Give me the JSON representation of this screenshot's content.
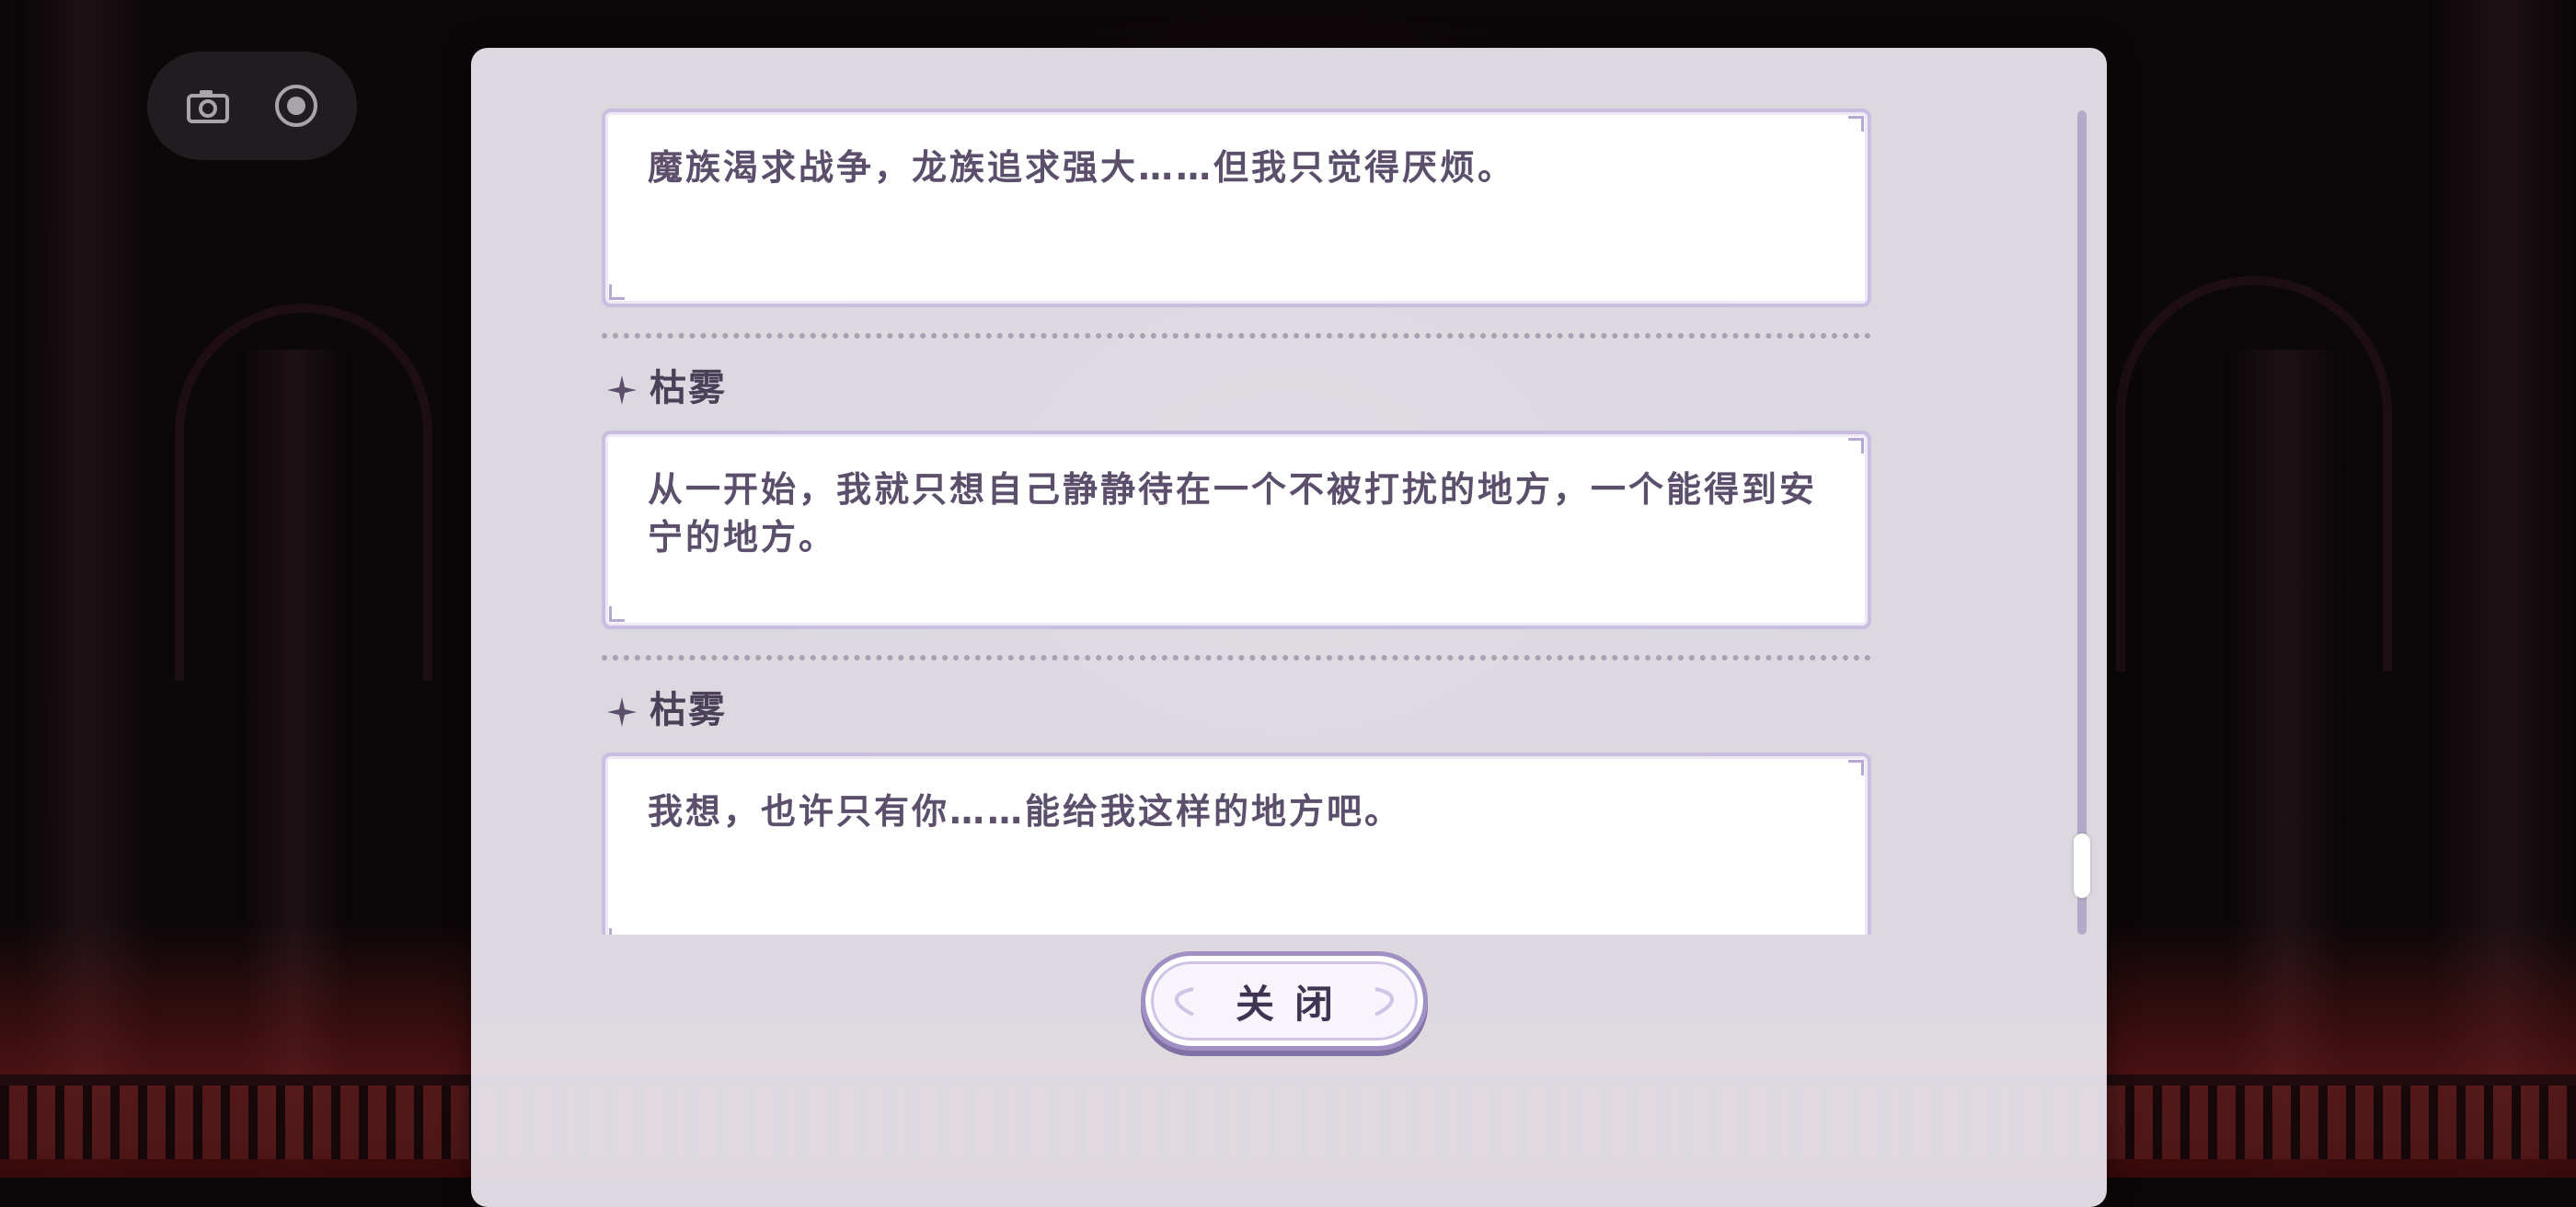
{
  "toolbar": {
    "camera_icon": "camera-icon",
    "record_icon": "record-icon"
  },
  "dialogue_log": {
    "entries": [
      {
        "speaker": "",
        "text": "魔族渴求战争，龙族追求强大……但我只觉得厌烦。"
      },
      {
        "speaker": "枯雾",
        "text": "从一开始，我就只想自己静静待在一个不被打扰的地方，一个能得到安宁的地方。"
      },
      {
        "speaker": "枯雾",
        "text": "我想，也许只有你……能给我这样的地方吧。"
      }
    ]
  },
  "actions": {
    "close_label": "关闭"
  },
  "colors": {
    "panel_bg": "#ece8f0",
    "bubble_border": "#c9bde0",
    "text": "#5b4f6b",
    "accent": "#9f8fc2"
  }
}
